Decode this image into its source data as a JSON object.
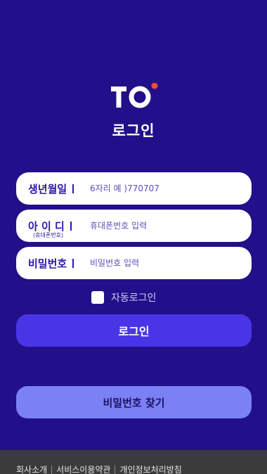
{
  "header": {
    "logo_text": "TO",
    "title": "로그인"
  },
  "form": {
    "birth": {
      "label": "생년월일",
      "placeholder": "6자리 예 )770707"
    },
    "id": {
      "label": "아 이 디",
      "sub": "(휴대폰번호)",
      "placeholder": "휴대폰번호 입력"
    },
    "password": {
      "label": "비밀번호",
      "placeholder": "비밀번호 입력"
    }
  },
  "auto_login": {
    "label": "자동로그인",
    "checked": false
  },
  "buttons": {
    "login": "로그인",
    "find_password": "비밀번호 찾기"
  },
  "footer": {
    "links": [
      "회사소개",
      "서비스이용약관",
      "개인정보처리방침"
    ]
  },
  "colors": {
    "background": "#21108a",
    "accent_dot": "#ef4b36",
    "login_button": "#4a35e6",
    "find_button": "#7b80f5"
  }
}
